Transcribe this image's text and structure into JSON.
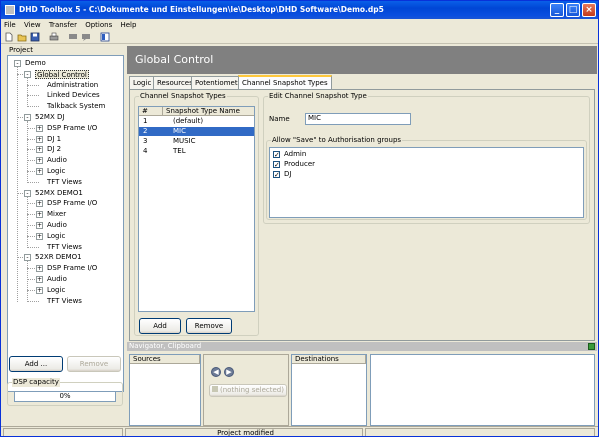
{
  "window": {
    "title": "DHD Toolbox 5 - C:\\Dokumente und Einstellungen\\le\\Desktop\\DHD Software\\Demo.dp5"
  },
  "menu": [
    "File",
    "View",
    "Transfer",
    "Options",
    "Help"
  ],
  "toolbar": {
    "icons": [
      "new-icon",
      "open-icon",
      "save-icon",
      "print-icon",
      "message-icon",
      "message-icon",
      "layout-icon"
    ]
  },
  "project": {
    "label": "Project",
    "tree": [
      {
        "label": "Demo",
        "level": 0,
        "exp": "-"
      },
      {
        "label": "Global Control",
        "level": 1,
        "exp": "-",
        "selected": true
      },
      {
        "label": "Administration",
        "level": 2
      },
      {
        "label": "Linked Devices",
        "level": 2
      },
      {
        "label": "Talkback System",
        "level": 2
      },
      {
        "label": "52MX DJ",
        "level": 1,
        "exp": "-"
      },
      {
        "label": "DSP Frame I/O",
        "level": 2,
        "exp": "+"
      },
      {
        "label": "DJ 1",
        "level": 2,
        "exp": "+"
      },
      {
        "label": "DJ 2",
        "level": 2,
        "exp": "+"
      },
      {
        "label": "Audio",
        "level": 2,
        "exp": "+"
      },
      {
        "label": "Logic",
        "level": 2,
        "exp": "+"
      },
      {
        "label": "TFT Views",
        "level": 2
      },
      {
        "label": "52MX DEMO1",
        "level": 1,
        "exp": "-"
      },
      {
        "label": "DSP Frame I/O",
        "level": 2,
        "exp": "+"
      },
      {
        "label": "Mixer",
        "level": 2,
        "exp": "+"
      },
      {
        "label": "Audio",
        "level": 2,
        "exp": "+"
      },
      {
        "label": "Logic",
        "level": 2,
        "exp": "+"
      },
      {
        "label": "TFT Views",
        "level": 2
      },
      {
        "label": "52XR DEMO1",
        "level": 1,
        "exp": "-"
      },
      {
        "label": "DSP Frame I/O",
        "level": 2,
        "exp": "+"
      },
      {
        "label": "Audio",
        "level": 2,
        "exp": "+"
      },
      {
        "label": "Logic",
        "level": 2,
        "exp": "+"
      },
      {
        "label": "TFT Views",
        "level": 2
      }
    ],
    "add_label": "Add ...",
    "remove_label": "Remove",
    "dsp_label": "DSP capacity",
    "dsp_value": "0%",
    "dsp_fraction": 0
  },
  "header": {
    "title": "Global Control"
  },
  "tabs": [
    {
      "label": "Logic"
    },
    {
      "label": "Resources"
    },
    {
      "label": "Potentiometer"
    },
    {
      "label": "Channel Snapshot Types",
      "active": true
    }
  ],
  "snapshot": {
    "group_label": "Channel Snapshot Types",
    "col_num": "#",
    "col_name": "Snapshot Type Name",
    "rows": [
      {
        "num": "1",
        "name": "(default)"
      },
      {
        "num": "2",
        "name": "MIC",
        "selected": true
      },
      {
        "num": "3",
        "name": "MUSIC"
      },
      {
        "num": "4",
        "name": "TEL"
      }
    ],
    "add_label": "Add",
    "remove_label": "Remove"
  },
  "edit": {
    "group_label": "Edit Channel Snapshot Type",
    "name_label": "Name",
    "name_value": "MIC",
    "allow_label": "Allow \"Save\" to Authorisation groups",
    "groups": [
      {
        "label": "Admin",
        "checked": true
      },
      {
        "label": "Producer",
        "checked": true
      },
      {
        "label": "DJ",
        "checked": true
      }
    ]
  },
  "navigator": {
    "title": "Navigator, Clipboard",
    "sources_label": "Sources",
    "destinations_label": "Destinations",
    "nothing_selected_label": "(nothing selected)"
  },
  "status": {
    "text": "Project modified"
  }
}
